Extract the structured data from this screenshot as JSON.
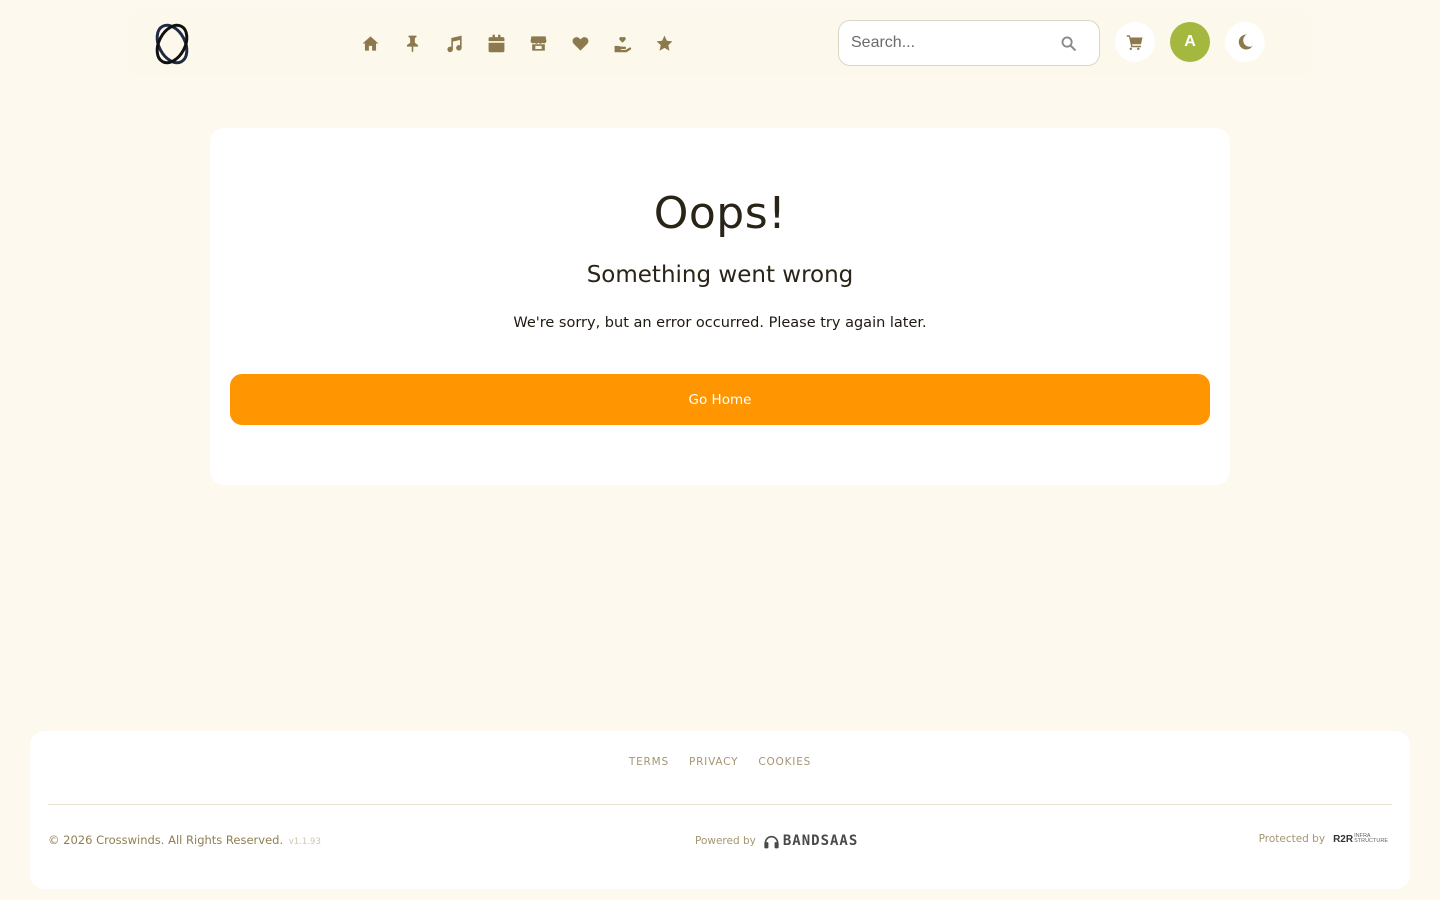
{
  "header": {
    "nav": [
      "home-icon",
      "pin-icon",
      "music-icon",
      "calendar-icon",
      "store-icon",
      "heart-icon",
      "donate-icon",
      "star-icon"
    ],
    "search_placeholder": "Search...",
    "avatar_initial": "A"
  },
  "error": {
    "title": "Oops!",
    "subtitle": "Something went wrong",
    "message": "We're sorry, but an error occurred. Please try again later.",
    "button_label": "Go Home"
  },
  "footer": {
    "links": [
      "TERMS",
      "PRIVACY",
      "COOKIES"
    ],
    "copyright": "© 2026 Crosswinds. All Rights Reserved.",
    "version": "v1.1.93",
    "powered_by": "Powered by",
    "brand": "BANDSAAS",
    "protected_by": "Protected by",
    "r2r_main": "R2R",
    "r2r_line1": "INFRA",
    "r2r_line2": "STRUCTURE"
  },
  "colors": {
    "background": "#fdf9ee",
    "accent": "#ff9500",
    "icon": "#8c7a4e",
    "avatar": "#a4b83f"
  }
}
